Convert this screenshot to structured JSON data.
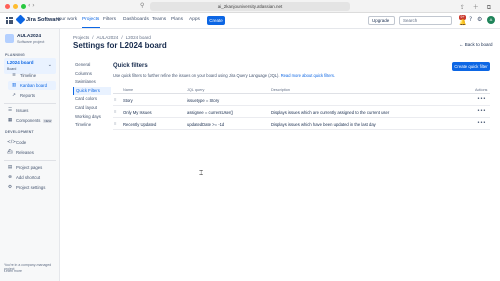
{
  "browser": {
    "url": "ai_2kanjouniversity.atlassian.net",
    "nav_icons": "‹ ›",
    "colors": {
      "close": "#ff5f57",
      "min": "#febc2e",
      "max": "#28c840"
    }
  },
  "topnav": {
    "app_name": "Jira Software",
    "items": [
      "Your work",
      "Projects",
      "Filters",
      "Dashboards",
      "Teams",
      "Plans",
      "Apps"
    ],
    "create_label": "Create",
    "upgrade_label": "Upgrade",
    "search_placeholder": "Search",
    "notif_count": "9+",
    "avatar_initials": "A"
  },
  "sidebar": {
    "project_name": "AULA2024",
    "project_type": "Software project",
    "planning_label": "PLANNING",
    "board_name": "L2024 board",
    "board_type": "Board",
    "board_items": [
      "Timeline",
      "Kanban board",
      "Reports"
    ],
    "issues_label": "Issues",
    "components_label": "Components",
    "components_badge": "NEW",
    "development_label": "DEVELOPMENT",
    "dev_items": [
      "Code",
      "Releases"
    ],
    "bottom_items": [
      "Project pages",
      "Add shortcut",
      "Project settings"
    ],
    "footer_text": "You're in a company-managed project",
    "footer_link": "Learn more"
  },
  "breadcrumb": [
    "Projects",
    "AULA2024",
    "L2024 board"
  ],
  "page": {
    "title": "Settings for L2024 board",
    "back_link": "Back to board"
  },
  "settings_nav": [
    "General",
    "Columns",
    "Swimlanes",
    "Quick Filters",
    "Card colors",
    "Card layout",
    "Working days",
    "Timeline"
  ],
  "quick_filters": {
    "title": "Quick filters",
    "description": "Use quick filters to further refine the issues on your board using Jira Query Language (JQL).",
    "learn_more": "Read more about quick filters.",
    "create_button": "Create quick filter",
    "columns": [
      "Name",
      "JQL query",
      "Description",
      "Actions"
    ],
    "rows": [
      {
        "name": "Story",
        "jql": "issuetype = Story",
        "description": ""
      },
      {
        "name": "Only My Issues",
        "jql": "assignee = currentUser()",
        "description": "Displays issues which are currently assigned to the current user"
      },
      {
        "name": "Recently Updated",
        "jql": "updatedDate >= -1d",
        "description": "Displays issues which have been updated in the last day"
      }
    ]
  }
}
